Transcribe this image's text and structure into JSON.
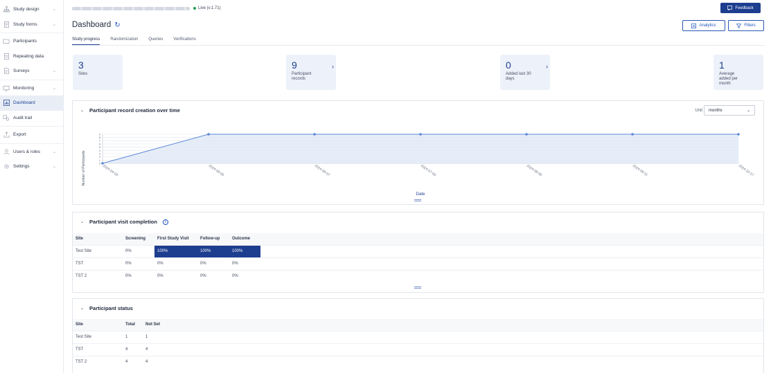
{
  "sidebar": {
    "items": [
      {
        "label": "Study design",
        "icon": "sitemap-icon",
        "chevron": true
      },
      {
        "label": "Study forms",
        "icon": "form-icon",
        "chevron": true
      },
      {
        "label": "Participants",
        "icon": "folder-icon",
        "chevron": false
      },
      {
        "label": "Repeating data",
        "icon": "repeat-doc-icon",
        "chevron": false
      },
      {
        "label": "Surveys",
        "icon": "survey-icon",
        "chevron": true
      },
      {
        "label": "Monitoring",
        "icon": "monitor-icon",
        "chevron": true
      },
      {
        "label": "Dashboard",
        "icon": "chart-icon",
        "chevron": false,
        "active": true
      },
      {
        "label": "Audit trail",
        "icon": "audit-icon",
        "chevron": false
      },
      {
        "label": "Export",
        "icon": "export-icon",
        "chevron": false
      },
      {
        "label": "Users & roles",
        "icon": "users-icon",
        "chevron": true
      },
      {
        "label": "Settings",
        "icon": "gear-icon",
        "chevron": true
      }
    ]
  },
  "topbar": {
    "status": "Live (v.1.71)",
    "feedback_label": "Feedback"
  },
  "page": {
    "title": "Dashboard",
    "analytics_label": "Analytics",
    "filters_label": "Filters"
  },
  "tabs": [
    {
      "label": "Study progress",
      "active": true
    },
    {
      "label": "Randomization"
    },
    {
      "label": "Queries"
    },
    {
      "label": "Verifications"
    }
  ],
  "stats": [
    {
      "value": "3",
      "label": "Sites",
      "arrow": false
    },
    {
      "value": "9",
      "label": "Participant records",
      "arrow": true
    },
    {
      "value": "0",
      "label": "Added last 30 days",
      "arrow": true
    },
    {
      "value": "1",
      "label": "Average added per month",
      "arrow": false
    }
  ],
  "creation_chart": {
    "title": "Participant record creation over time",
    "unit_label": "Unit",
    "unit_value": "months"
  },
  "chart_data": {
    "type": "line",
    "title": "",
    "xlabel": "Date",
    "ylabel": "Number of Participants",
    "x": [
      "2024-04-03",
      "2024-05-05",
      "2024-06-07",
      "2024-07-03",
      "2024-08-05",
      "2024-09-11",
      "2024-10-17"
    ],
    "series": [
      {
        "values": [
          0,
          9,
          9,
          9,
          9,
          9,
          9
        ]
      }
    ],
    "ylim": [
      0,
      9
    ],
    "grid": true,
    "area_fill": true,
    "colors": {
      "line": "#5a86d6",
      "fill": "#dde7f7"
    }
  },
  "visit_table": {
    "title": "Participant visit completion",
    "headers": [
      "Site",
      "Screening",
      "First Study Visit",
      "Follow-up",
      "Outcome"
    ],
    "rows": [
      [
        "Test Site",
        "0%",
        "100%",
        "100%",
        "100%"
      ],
      [
        "TST",
        "0%",
        "0%",
        "0%",
        "0%"
      ],
      [
        "TST 2",
        "0%",
        "0%",
        "0%",
        "0%"
      ]
    ],
    "complete_color": "#1d3d8f"
  },
  "status_table": {
    "title": "Participant status",
    "headers": [
      "Site",
      "Total",
      "Not Set"
    ],
    "rows": [
      [
        "Test Site",
        "1",
        "1"
      ],
      [
        "TST",
        "4",
        "4"
      ],
      [
        "TST 2",
        "4",
        "4"
      ]
    ]
  }
}
